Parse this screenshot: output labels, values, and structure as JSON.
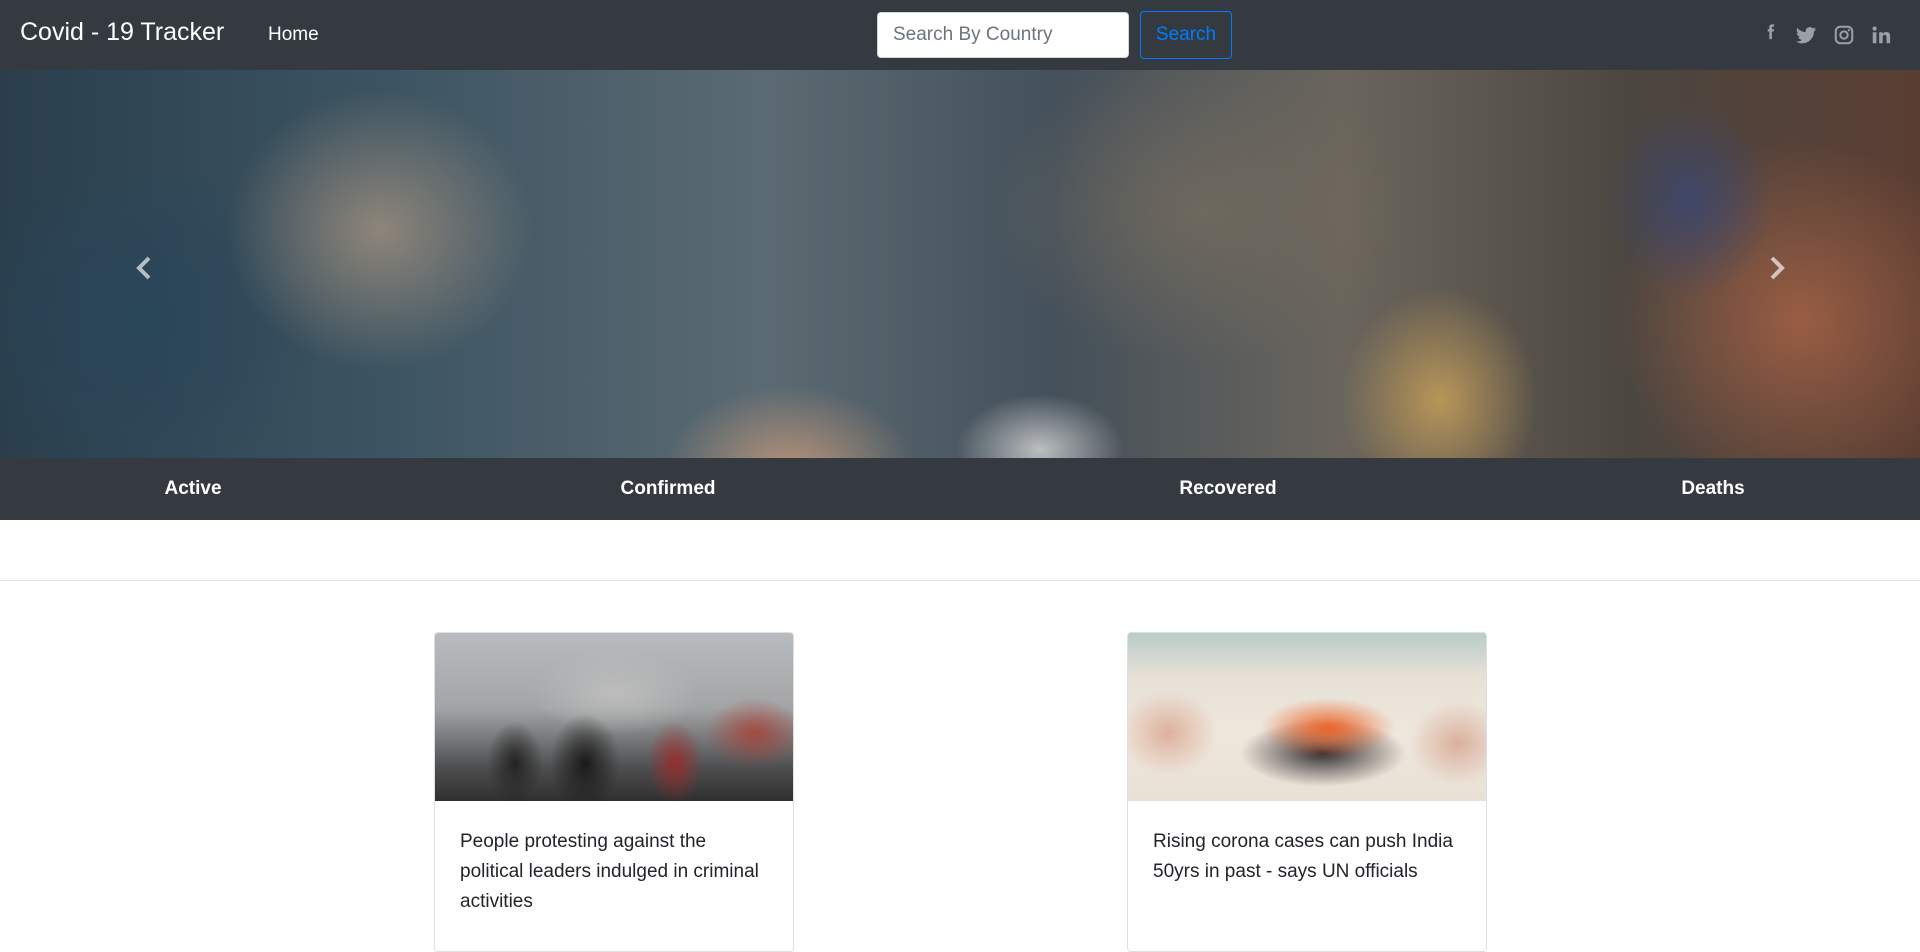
{
  "navbar": {
    "brand": "Covid - 19 Tracker",
    "home_label": "Home",
    "search_placeholder": "Search By Country",
    "search_button": "Search",
    "social": [
      {
        "icon": "facebook-icon"
      },
      {
        "icon": "twitter-icon"
      },
      {
        "icon": "instagram-icon"
      },
      {
        "icon": "linkedin-icon"
      }
    ]
  },
  "carousel": {
    "prev_icon": "chevron-left-icon",
    "next_icon": "chevron-right-icon"
  },
  "stats": {
    "active": "Active",
    "confirmed": "Confirmed",
    "recovered": "Recovered",
    "deaths": "Deaths"
  },
  "news": [
    {
      "text": "People protesting against the political leaders indulged in criminal activities"
    },
    {
      "text": "Rising corona cases can push India 50yrs in past - says UN officials"
    }
  ],
  "colors": {
    "navbar_bg": "#343a40",
    "primary": "#007bff",
    "text": "#212529"
  }
}
